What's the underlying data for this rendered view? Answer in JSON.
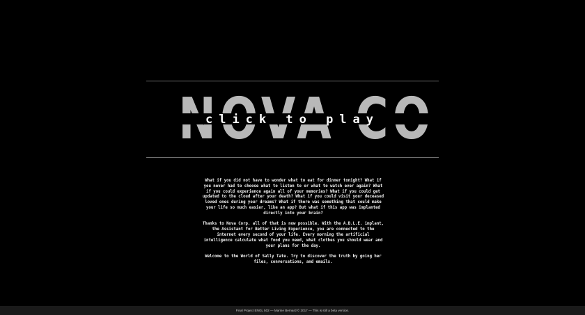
{
  "hero": {
    "logo_text": "NOVA CORP",
    "play_label": "click to play"
  },
  "intro": {
    "paragraphs": [
      "What if you did not have to wonder what to eat for dinner tonight? What if you never had to choose what to listen to or what to watch ever again? What if you could experience again all of your memories? What if you could get updated to the cloud after your death? What if you could visit your deceased loved ones during your dreams? What if there was something that could make your life so much easier, like an app? But what if this app was implanted directly into your brain?",
      "Thanks to Nova Corp. all of that is now possible. With the A.B.L.E. implant, the Assistant for Better Living Experience, you are connected to the internet every second of your life. Every morning the artificial intelligence calculate what food you need, what clothes you should wear and your plans for the day.",
      "Welcome to the World of Sally Tate. Try to discover the truth by going her files, conversations, and emails."
    ]
  },
  "footer": {
    "text": "Final Project ENGL 502 — Marine Bernard © 2017 — This is still a beta version."
  }
}
